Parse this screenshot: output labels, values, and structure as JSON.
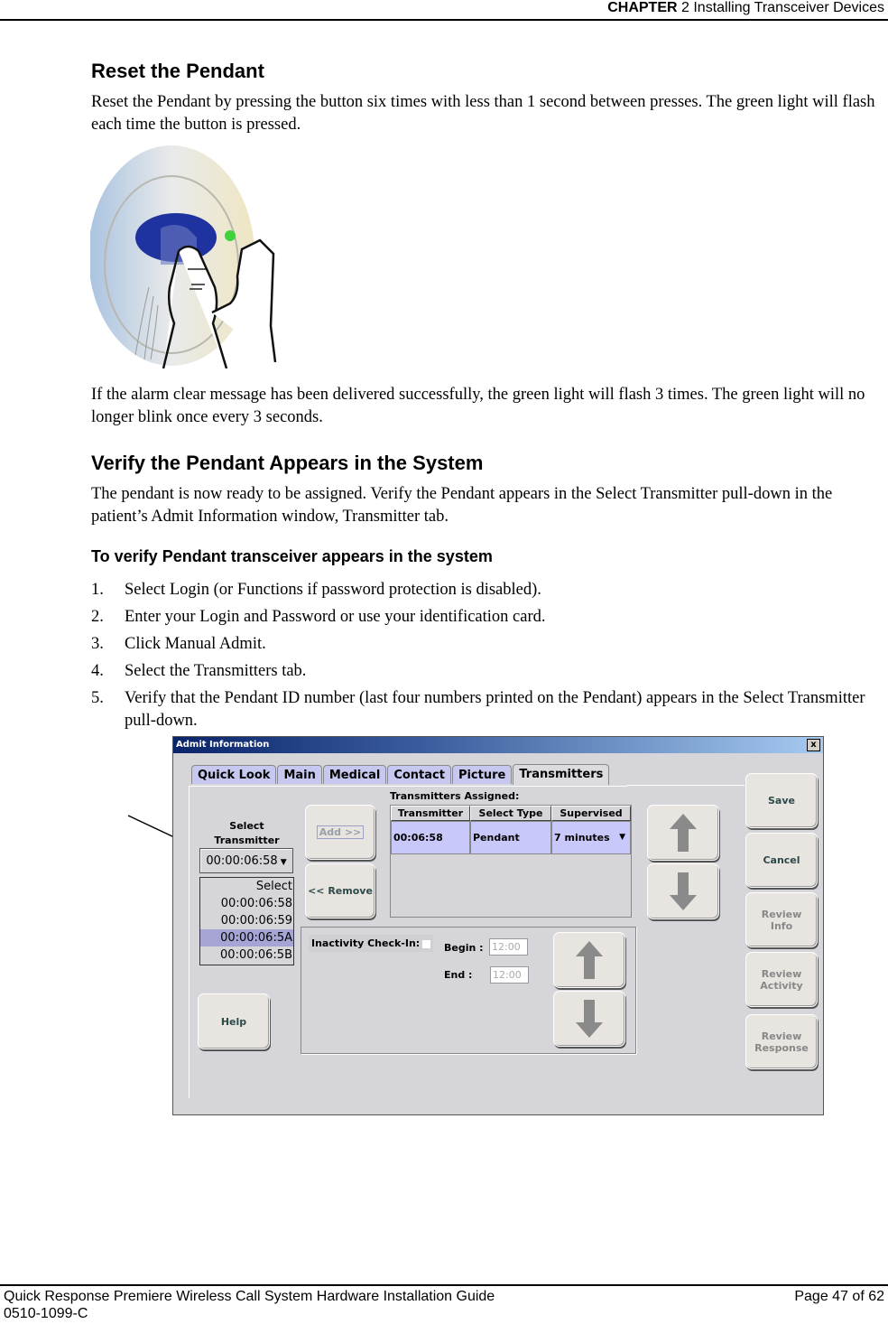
{
  "header": {
    "chapter_label": "CHAPTER",
    "chapter_rest": "2 Installing Transceiver Devices"
  },
  "sections": {
    "reset": {
      "title": "Reset the Pendant",
      "paragraph": "Reset the Pendant by pressing the button six times with less than 1 second between presses. The green light will flash each time the button is pressed.",
      "after_image": "If the alarm clear message has been delivered successfully, the green light will flash 3 times. The green light will no longer blink once every 3 seconds."
    },
    "verify": {
      "title": "Verify the Pendant Appears in the System",
      "paragraph": "The pendant is now ready to be assigned. Verify the Pendant appears in the Select Transmitter  pull-down  in the patient’s Admit Information window, Transmitter tab.",
      "procedure_title": "To verify Pendant transceiver appears in the system",
      "steps": [
        {
          "num": "1.",
          "text": "Select Login (or Functions if password protection is disabled)."
        },
        {
          "num": "2.",
          "text": "Enter your Login and Password or use your identification card."
        },
        {
          "num": "3.",
          "text": "Click Manual Admit."
        },
        {
          "num": "4.",
          "text": "Select the Transmitters tab."
        },
        {
          "num": "5.",
          "text": "Verify that the Pendant ID number (last four numbers printed on the Pendant) appears in the Select Transmitter pull-down."
        }
      ]
    }
  },
  "illustration": {
    "description": "hand pressing pendant button",
    "led_color": "#3fd23a",
    "button_color": "#1f33a0"
  },
  "dialog": {
    "title": "Admit Information",
    "close_label": "x",
    "tabs": [
      {
        "label": "Quick Look",
        "active": false
      },
      {
        "label": "Main",
        "active": false
      },
      {
        "label": "Medical",
        "active": false
      },
      {
        "label": "Contact",
        "active": false
      },
      {
        "label": "Picture",
        "active": false
      },
      {
        "label": "Transmitters",
        "active": true
      }
    ],
    "select_transmitter_label_1": "Select",
    "select_transmitter_label_2": "Transmitter",
    "select_value": "00:00:06:58",
    "dropdown_options": [
      {
        "label": "Select",
        "selected": false
      },
      {
        "label": "00:00:06:58",
        "selected": false
      },
      {
        "label": "00:00:06:59",
        "selected": false
      },
      {
        "label": "00:00:06:5A",
        "selected": true
      },
      {
        "label": "00:00:06:5B",
        "selected": false
      }
    ],
    "add_label": "Add >>",
    "remove_label": "<< Remove",
    "assigned_title": "Transmitters Assigned:",
    "columns": [
      "Transmitter",
      "Select Type",
      "Supervised"
    ],
    "rows": [
      {
        "transmitter": "00:06:58",
        "type": "Pendant",
        "supervised": "7 minutes"
      }
    ],
    "inactivity_label": "Inactivity Check-In:",
    "inactivity_checked": false,
    "begin_label": "Begin :",
    "begin_value": "12:00",
    "end_label": "End :",
    "end_value": "12:00",
    "help_label": "Help",
    "side_buttons": [
      {
        "line1": "Save",
        "line2": "",
        "enabled": true
      },
      {
        "line1": "Cancel",
        "line2": "",
        "enabled": true
      },
      {
        "line1": "Review",
        "line2": "Info",
        "enabled": false
      },
      {
        "line1": "Review",
        "line2": "Activity",
        "enabled": false
      },
      {
        "line1": "Review",
        "line2": "Response",
        "enabled": false
      }
    ],
    "colors": {
      "title_gradient_start": "#0a246a",
      "title_gradient_end": "#a6caf0",
      "tab_bg": "#c7c8f0",
      "panel_bg": "#d6d5d9",
      "row_bg": "#c8c8fa",
      "selected_option_bg": "#a5a4d4"
    }
  },
  "footer": {
    "guide_title": "Quick Response Premiere Wireless Call System Hardware Installation Guide",
    "doc_number": "0510-1099-C",
    "page_label": "Page 47 of 62"
  }
}
